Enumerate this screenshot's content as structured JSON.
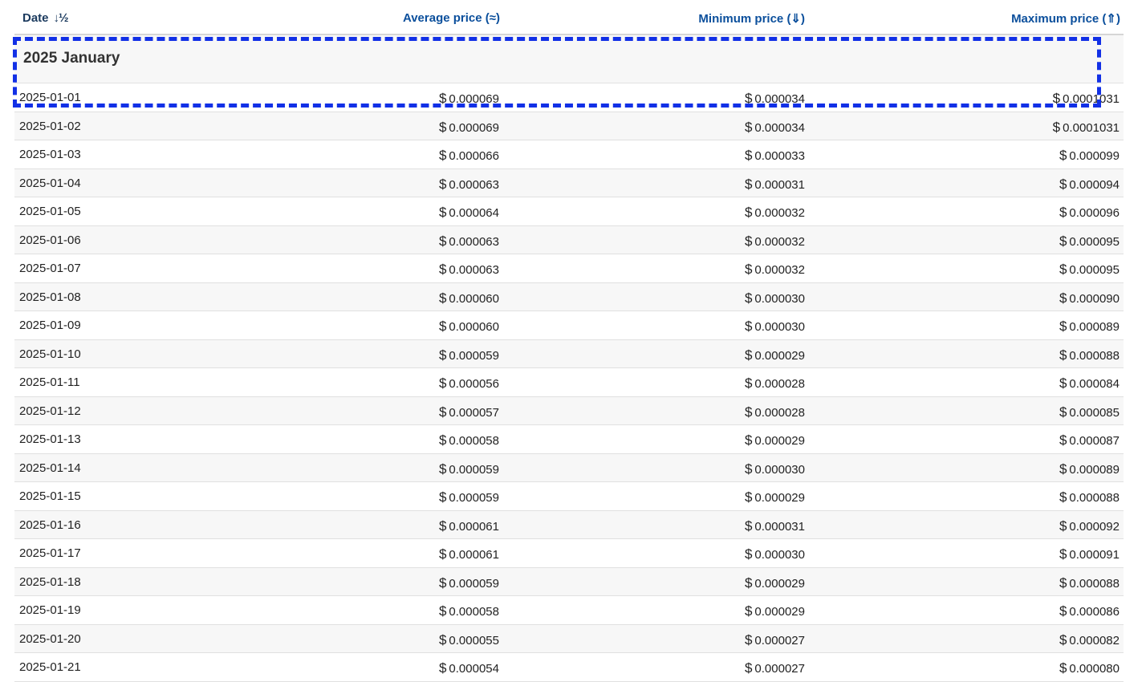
{
  "table": {
    "headers": {
      "date": "Date",
      "average": "Average price (≈)",
      "minimum": "Minimum price (⇓)",
      "maximum": "Maximum price (⇑)"
    },
    "sort_icon": "sort-ascending-icon",
    "group_title": "2025 January",
    "currency_symbol": "$",
    "rows": [
      {
        "date": "2025-01-01",
        "avg": "0.000069",
        "min": "0.000034",
        "max": "0.0001031"
      },
      {
        "date": "2025-01-02",
        "avg": "0.000069",
        "min": "0.000034",
        "max": "0.0001031"
      },
      {
        "date": "2025-01-03",
        "avg": "0.000066",
        "min": "0.000033",
        "max": "0.000099"
      },
      {
        "date": "2025-01-04",
        "avg": "0.000063",
        "min": "0.000031",
        "max": "0.000094"
      },
      {
        "date": "2025-01-05",
        "avg": "0.000064",
        "min": "0.000032",
        "max": "0.000096"
      },
      {
        "date": "2025-01-06",
        "avg": "0.000063",
        "min": "0.000032",
        "max": "0.000095"
      },
      {
        "date": "2025-01-07",
        "avg": "0.000063",
        "min": "0.000032",
        "max": "0.000095"
      },
      {
        "date": "2025-01-08",
        "avg": "0.000060",
        "min": "0.000030",
        "max": "0.000090"
      },
      {
        "date": "2025-01-09",
        "avg": "0.000060",
        "min": "0.000030",
        "max": "0.000089"
      },
      {
        "date": "2025-01-10",
        "avg": "0.000059",
        "min": "0.000029",
        "max": "0.000088"
      },
      {
        "date": "2025-01-11",
        "avg": "0.000056",
        "min": "0.000028",
        "max": "0.000084"
      },
      {
        "date": "2025-01-12",
        "avg": "0.000057",
        "min": "0.000028",
        "max": "0.000085"
      },
      {
        "date": "2025-01-13",
        "avg": "0.000058",
        "min": "0.000029",
        "max": "0.000087"
      },
      {
        "date": "2025-01-14",
        "avg": "0.000059",
        "min": "0.000030",
        "max": "0.000089"
      },
      {
        "date": "2025-01-15",
        "avg": "0.000059",
        "min": "0.000029",
        "max": "0.000088"
      },
      {
        "date": "2025-01-16",
        "avg": "0.000061",
        "min": "0.000031",
        "max": "0.000092"
      },
      {
        "date": "2025-01-17",
        "avg": "0.000061",
        "min": "0.000030",
        "max": "0.000091"
      },
      {
        "date": "2025-01-18",
        "avg": "0.000059",
        "min": "0.000029",
        "max": "0.000088"
      },
      {
        "date": "2025-01-19",
        "avg": "0.000058",
        "min": "0.000029",
        "max": "0.000086"
      },
      {
        "date": "2025-01-20",
        "avg": "0.000055",
        "min": "0.000027",
        "max": "0.000082"
      },
      {
        "date": "2025-01-21",
        "avg": "0.000054",
        "min": "0.000027",
        "max": "0.000080"
      }
    ]
  },
  "colors": {
    "header_link": "#0b4f9c",
    "highlight": "#1230e6"
  }
}
